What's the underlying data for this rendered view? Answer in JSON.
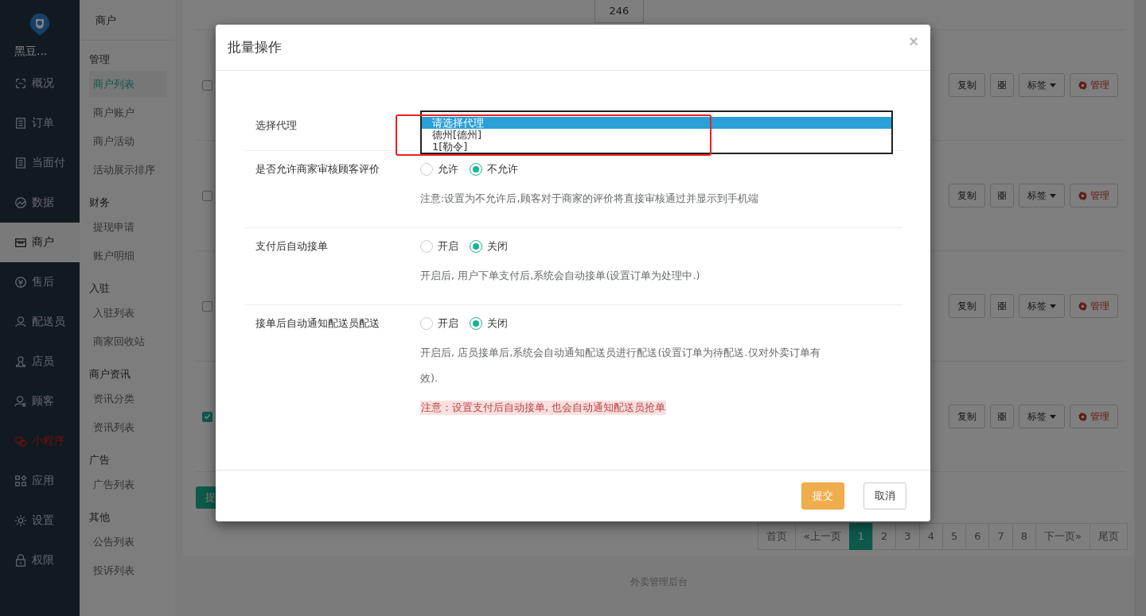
{
  "sidebar": {
    "brand": "黑豆...",
    "items": [
      {
        "label": "概况",
        "selected": false,
        "accent": false
      },
      {
        "label": "订单",
        "selected": false,
        "accent": false
      },
      {
        "label": "当面付",
        "selected": false,
        "accent": false
      },
      {
        "label": "数据",
        "selected": false,
        "accent": false
      },
      {
        "label": "商户",
        "selected": true,
        "accent": false
      },
      {
        "label": "售后",
        "selected": false,
        "accent": false
      },
      {
        "label": "配送员",
        "selected": false,
        "accent": false
      },
      {
        "label": "店员",
        "selected": false,
        "accent": false
      },
      {
        "label": "顾客",
        "selected": false,
        "accent": false
      },
      {
        "label": "小程序",
        "selected": false,
        "accent": true
      },
      {
        "label": "应用",
        "selected": false,
        "accent": false
      },
      {
        "label": "设置",
        "selected": false,
        "accent": false
      },
      {
        "label": "权限",
        "selected": false,
        "accent": false
      }
    ]
  },
  "subnav": {
    "title": "商户",
    "groups": [
      {
        "heading": "管理",
        "items": [
          {
            "label": "商户列表",
            "selected": true
          },
          {
            "label": "商户账户",
            "selected": false
          },
          {
            "label": "商户活动",
            "selected": false
          },
          {
            "label": "活动展示排序",
            "selected": false
          }
        ]
      },
      {
        "heading": "财务",
        "items": [
          {
            "label": "提现申请",
            "selected": false
          },
          {
            "label": "账户明细",
            "selected": false
          }
        ]
      },
      {
        "heading": "入驻",
        "items": [
          {
            "label": "入驻列表",
            "selected": false
          },
          {
            "label": "商家回收站",
            "selected": false
          }
        ]
      },
      {
        "heading": "商户资讯",
        "items": [
          {
            "label": "资讯分类",
            "selected": false
          },
          {
            "label": "资讯列表",
            "selected": false
          }
        ]
      },
      {
        "heading": "广告",
        "items": [
          {
            "label": "广告列表",
            "selected": false
          }
        ]
      },
      {
        "heading": "其他",
        "items": [
          {
            "label": "公告列表",
            "selected": false
          },
          {
            "label": "投诉列表",
            "selected": false
          }
        ]
      }
    ]
  },
  "list": {
    "counter": "246",
    "rows": [
      {
        "checked": false,
        "copy": "复制",
        "tag": "标签",
        "manage": "管理"
      },
      {
        "checked": false,
        "copy": "复制",
        "tag": "标签",
        "manage": "管理"
      },
      {
        "checked": false,
        "copy": "复制",
        "tag": "标签",
        "manage": "管理"
      },
      {
        "checked": true,
        "copy": "复制",
        "tag": "标签",
        "manage": "管理"
      }
    ],
    "submit_button": "提",
    "pagination": [
      {
        "label": "首页",
        "selected": false
      },
      {
        "label": "«上一页",
        "selected": false
      },
      {
        "label": "1",
        "selected": true
      },
      {
        "label": "2",
        "selected": false
      },
      {
        "label": "3",
        "selected": false
      },
      {
        "label": "4",
        "selected": false
      },
      {
        "label": "5",
        "selected": false
      },
      {
        "label": "6",
        "selected": false
      },
      {
        "label": "7",
        "selected": false
      },
      {
        "label": "8",
        "selected": false
      },
      {
        "label": "下一页»",
        "selected": false
      },
      {
        "label": "尾页",
        "selected": false
      }
    ],
    "footer": "外卖管理后台"
  },
  "modal": {
    "title": "批量操作",
    "close": "×",
    "fields": [
      {
        "kind": "select",
        "label": "选择代理",
        "options": [
          {
            "label": "请选择代理",
            "selected": true
          },
          {
            "label": "德州[德州]",
            "selected": false
          },
          {
            "label": "1[勒令]",
            "selected": false
          }
        ]
      },
      {
        "kind": "radio",
        "label": "是否允许商家审核顾客评价",
        "options": [
          {
            "label": "允许",
            "selected": false
          },
          {
            "label": "不允许",
            "selected": true
          }
        ],
        "notes": [
          {
            "kind": "plain",
            "text": "注意:设置为不允许后,顾客对于商家的评价将直接审核通过并显示到手机端"
          }
        ]
      },
      {
        "kind": "radio",
        "label": "支付后自动接单",
        "options": [
          {
            "label": "开启",
            "selected": false
          },
          {
            "label": "关闭",
            "selected": true
          }
        ],
        "notes": [
          {
            "kind": "plain",
            "text": "开启后, 用户下单支付后,系统会自动接单(设置订单为处理中.)"
          }
        ]
      },
      {
        "kind": "radio",
        "label": "接单后自动通知配送员配送",
        "options": [
          {
            "label": "开启",
            "selected": false
          },
          {
            "label": "关闭",
            "selected": true
          }
        ],
        "notes": [
          {
            "kind": "plain",
            "text": "开启后, 店员接单后,系统会自动通知配送员进行配送(设置订单为待配送.仅对外卖订单有效)."
          },
          {
            "kind": "warning",
            "text": "注意：设置支付后自动接单, 也会自动通知配送员抢单"
          }
        ]
      }
    ],
    "submit": "提交",
    "cancel": "取消"
  }
}
